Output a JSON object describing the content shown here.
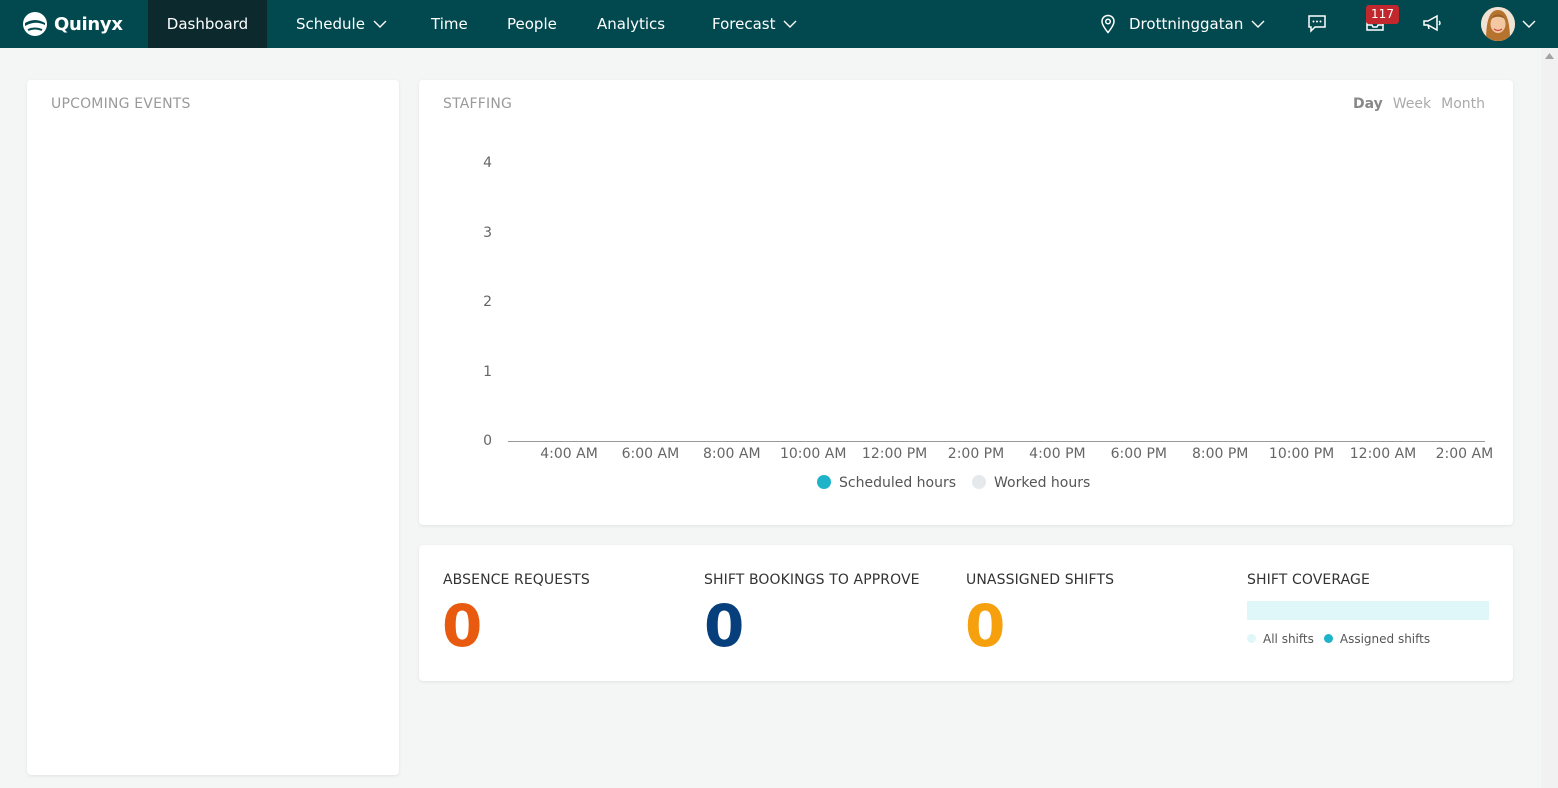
{
  "brand": {
    "name": "Quinyx",
    "header_color": "#02494f"
  },
  "nav": {
    "items": [
      {
        "label": "Dashboard",
        "has_dropdown": false,
        "active": true
      },
      {
        "label": "Schedule",
        "has_dropdown": true,
        "active": false
      },
      {
        "label": "Time",
        "has_dropdown": false,
        "active": false
      },
      {
        "label": "People",
        "has_dropdown": false,
        "active": false
      },
      {
        "label": "Analytics",
        "has_dropdown": false,
        "active": false
      },
      {
        "label": "Forecast",
        "has_dropdown": true,
        "active": false
      }
    ]
  },
  "header_right": {
    "location": "Drottninggatan",
    "location_icon": "map-pin-icon",
    "chat_icon": "chat-icon",
    "inbox_icon": "inbox-icon",
    "inbox_badge": "117",
    "announce_icon": "megaphone-icon",
    "user_avatar": "avatar"
  },
  "upcoming_events": {
    "title": "UPCOMING EVENTS"
  },
  "staffing": {
    "title": "STAFFING",
    "range_tabs": [
      {
        "label": "Day",
        "selected": true
      },
      {
        "label": "Week",
        "selected": false
      },
      {
        "label": "Month",
        "selected": false
      }
    ]
  },
  "chart_data": {
    "type": "line",
    "title": "",
    "xlabel": "",
    "ylabel": "",
    "y_ticks": [
      "0",
      "1",
      "2",
      "3",
      "4"
    ],
    "ylim": [
      0,
      4
    ],
    "categories": [
      "4:00 AM",
      "6:00 AM",
      "8:00 AM",
      "10:00 AM",
      "12:00 PM",
      "2:00 PM",
      "4:00 PM",
      "6:00 PM",
      "8:00 PM",
      "10:00 PM",
      "12:00 AM",
      "2:00 AM"
    ],
    "series": [
      {
        "name": "Scheduled hours",
        "color": "#1fb3c9",
        "values": []
      },
      {
        "name": "Worked hours",
        "color": "#e6e9ec",
        "values": []
      }
    ],
    "grid": false,
    "legend_position": "bottom-center"
  },
  "kpis": {
    "absence": {
      "title": "ABSENCE REQUESTS",
      "value": "0",
      "color": "#e85a0f"
    },
    "bookings": {
      "title": "SHIFT BOOKINGS TO APPROVE",
      "value": "0",
      "color": "#073f7d"
    },
    "unassigned": {
      "title": "UNASSIGNED SHIFTS",
      "value": "0",
      "color": "#f5a00c"
    },
    "coverage": {
      "title": "SHIFT COVERAGE",
      "legend": [
        {
          "label": "All shifts",
          "color": "#e0f7f9"
        },
        {
          "label": "Assigned shifts",
          "color": "#1fb3c9"
        }
      ]
    }
  }
}
